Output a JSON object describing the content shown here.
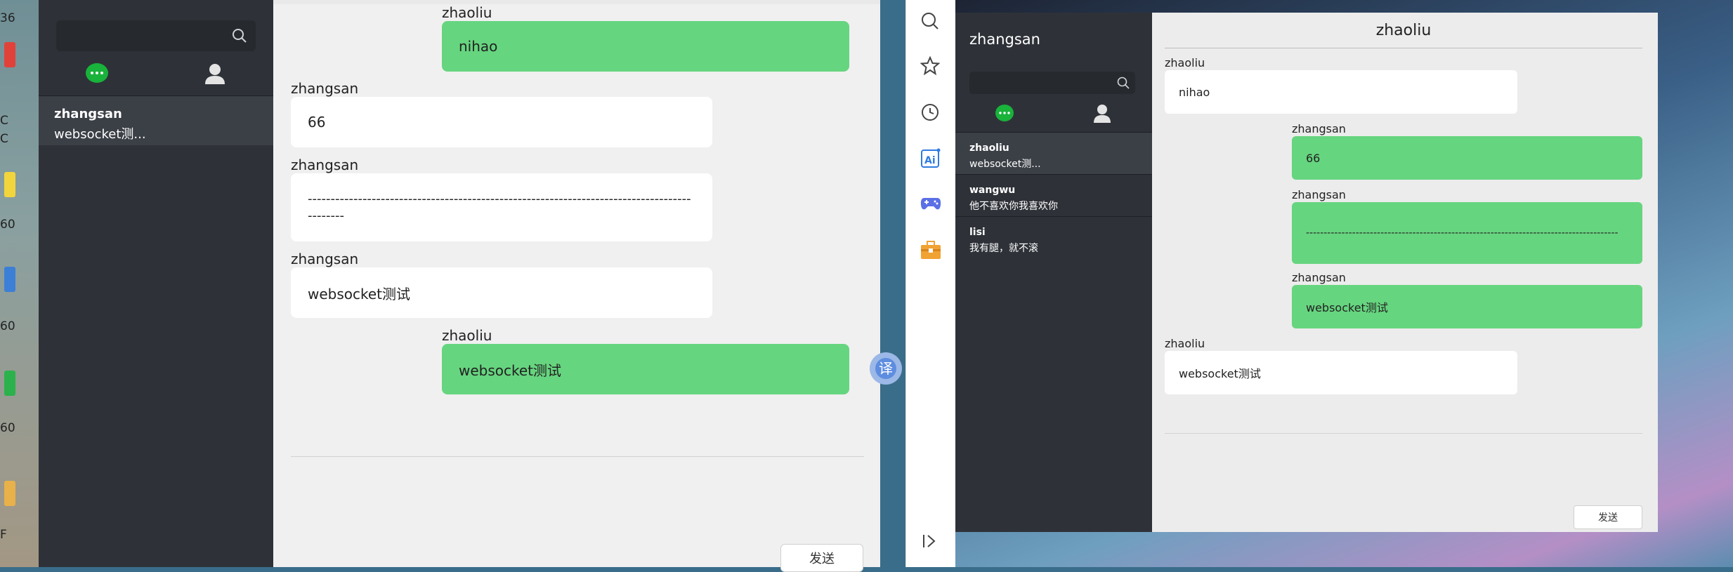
{
  "desktop": {
    "labels": [
      "36",
      "C",
      "C",
      "60",
      "60",
      "60",
      "F"
    ]
  },
  "left_window": {
    "sidebar": {
      "search_placeholder": "",
      "contacts": [
        {
          "name": "zhangsan",
          "preview": "websocket测..."
        }
      ]
    },
    "messages": [
      {
        "sender": "zhaoliu",
        "text": "nihao",
        "side": "right"
      },
      {
        "sender": "zhangsan",
        "text": "66",
        "side": "left"
      },
      {
        "sender": "zhangsan",
        "text": "--------------------------------------------------------------------------------------------",
        "side": "left"
      },
      {
        "sender": "zhangsan",
        "text": "websocket测试",
        "side": "left"
      },
      {
        "sender": "zhaoliu",
        "text": "websocket测试",
        "side": "right"
      }
    ],
    "input_value": "",
    "send_label": "发送",
    "translate_label": "译"
  },
  "right_window": {
    "sidebar": {
      "user_name": "zhangsan",
      "search_placeholder": "",
      "contacts": [
        {
          "name": "zhaoliu",
          "preview": "websocket测..."
        },
        {
          "name": "wangwu",
          "preview": "他不喜欢你我喜欢你"
        },
        {
          "name": "lisi",
          "preview": "我有腿，就不滚"
        }
      ]
    },
    "chat_title": "zhaoliu",
    "messages": [
      {
        "sender": "zhaoliu",
        "text": "nihao",
        "side": "left"
      },
      {
        "sender": "zhangsan",
        "text": "66",
        "side": "right"
      },
      {
        "sender": "zhangsan",
        "text": "----------------------------------------------------------------------------------------",
        "side": "right"
      },
      {
        "sender": "zhangsan",
        "text": "websocket测试",
        "side": "right"
      },
      {
        "sender": "zhaoliu",
        "text": "websocket测试",
        "side": "left"
      }
    ],
    "input_value": "",
    "send_label": "发送"
  },
  "colors": {
    "sidebar_bg": "#2e3238",
    "bubble_green": "#66d57f",
    "bubble_white": "#ffffff",
    "chat_icon_green": "#19b23b"
  },
  "toolbar_icons": [
    "search-icon",
    "star-icon",
    "history-icon",
    "ai-icon",
    "game-icon",
    "toolbox-icon",
    "collapse-icon"
  ]
}
